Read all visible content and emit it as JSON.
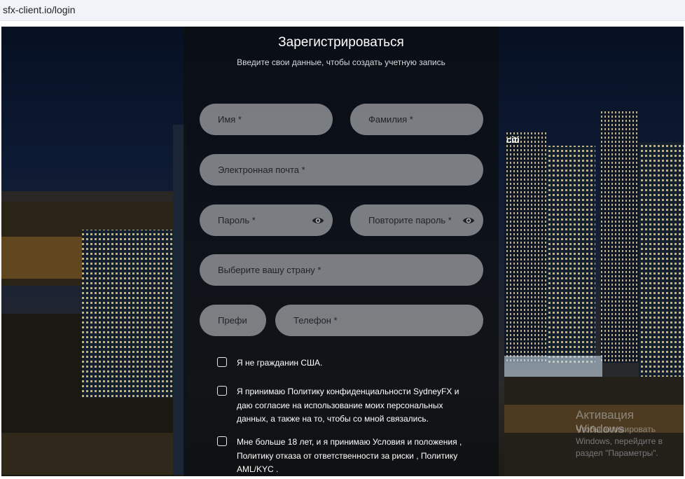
{
  "browser": {
    "url": "sfx-client.io/login"
  },
  "form": {
    "title": "Зарегистрироваться",
    "subtitle": "Введите свои данные, чтобы создать учетную запись",
    "first_name_placeholder": "Имя *",
    "last_name_placeholder": "Фамилия *",
    "email_placeholder": "Электронная почта *",
    "password_placeholder": "Пароль *",
    "repeat_password_placeholder": "Повторите пароль *",
    "country_placeholder": "Выберите вашу страну *",
    "prefix_placeholder": "Префи",
    "phone_placeholder": "Телефон *"
  },
  "checkboxes": [
    {
      "label": "Я не гражданин США.",
      "checked": false
    },
    {
      "label": "Я принимаю Политику конфиденциальности SydneyFX и даю согласие на использование моих персональных данных, а также на то, чтобы со мной связались.",
      "checked": false
    },
    {
      "label": "Мне больше 18 лет, и я принимаю  Условия и положения ,  Политику отказа от ответственности за риски ,  Политику AML/KYC .",
      "checked": false
    }
  ],
  "billboard": {
    "text": "citi"
  },
  "watermark": {
    "line1": "Активация Windows",
    "line2": "Чтобы активировать Windows, перейдите в раздел \"Параметры\"."
  },
  "colors": {
    "panel": "#0c0e12",
    "field": "#bec0c4",
    "text": "#ffffff"
  }
}
